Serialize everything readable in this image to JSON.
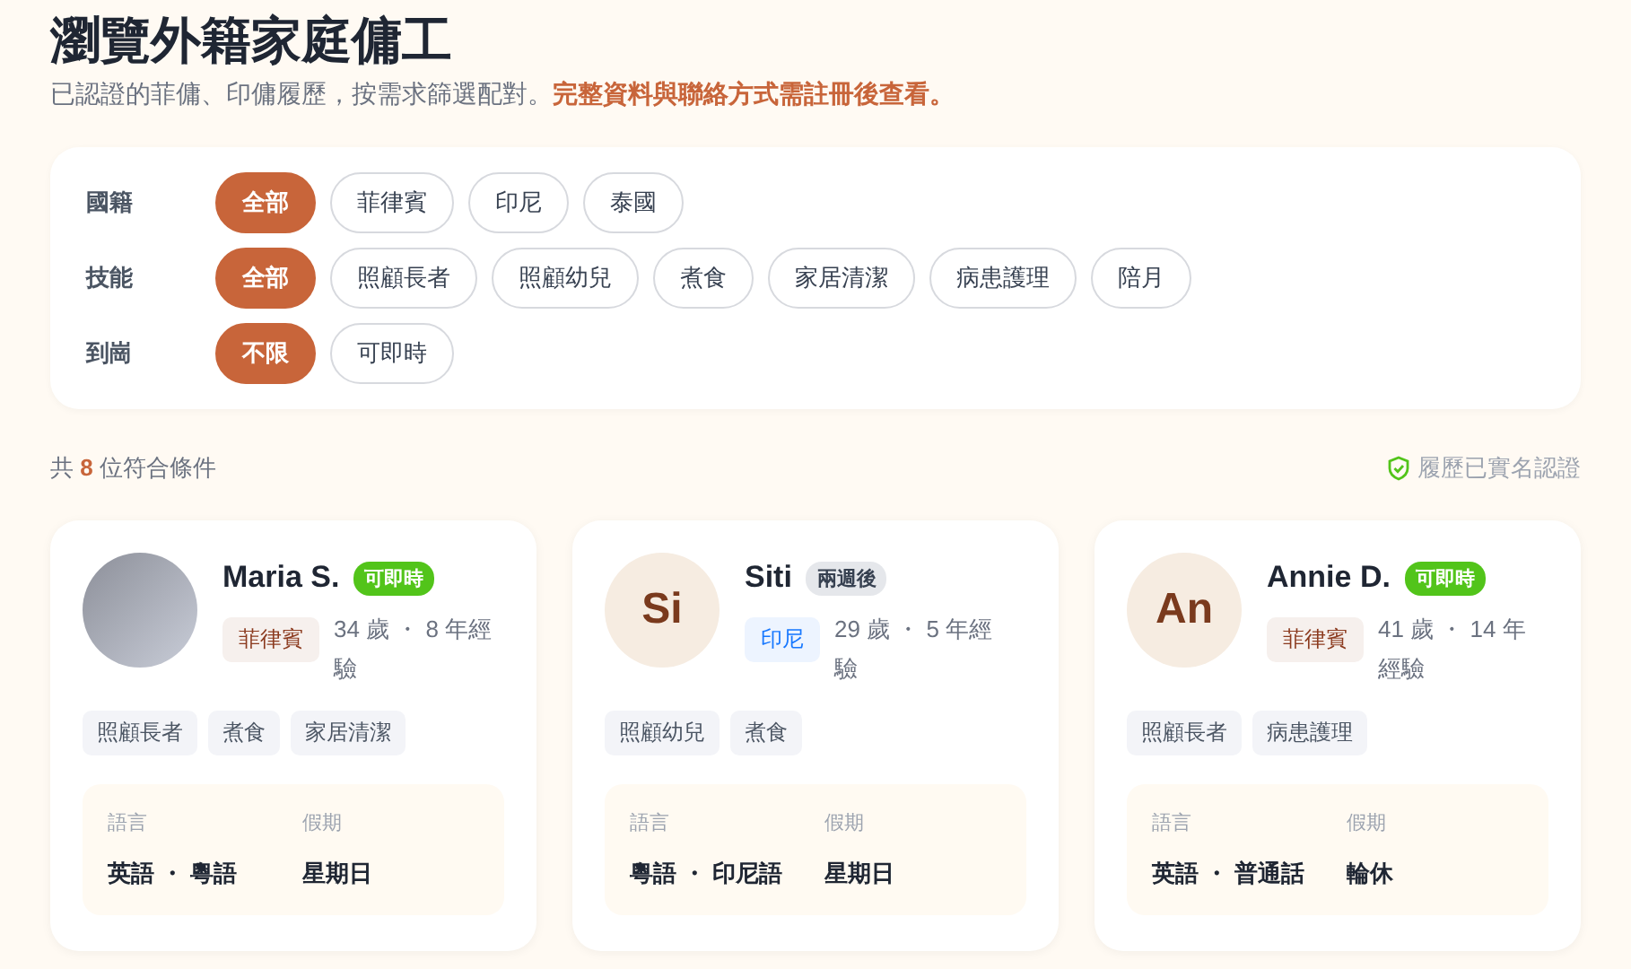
{
  "header": {
    "title": "瀏覽外籍家庭傭工",
    "subtitle": "已認證的菲傭、印傭履歷，按需求篩選配對。**完整資料與聯絡方式需註冊後查看。**"
  },
  "filters": [
    {
      "label": "國籍",
      "options": [
        {
          "label": "全部",
          "selected": true
        },
        {
          "label": "菲律賓",
          "selected": false
        },
        {
          "label": "印尼",
          "selected": false
        },
        {
          "label": "泰國",
          "selected": false
        }
      ]
    },
    {
      "label": "技能",
      "options": [
        {
          "label": "全部",
          "selected": true
        },
        {
          "label": "照顧長者",
          "selected": false
        },
        {
          "label": "照顧幼兒",
          "selected": false
        },
        {
          "label": "煮食",
          "selected": false
        },
        {
          "label": "家居清潔",
          "selected": false
        },
        {
          "label": "病患護理",
          "selected": false
        },
        {
          "label": "陪月",
          "selected": false
        }
      ]
    },
    {
      "label": "到崗",
      "options": [
        {
          "label": "不限",
          "selected": true
        },
        {
          "label": "可即時",
          "selected": false
        }
      ]
    }
  ],
  "results": {
    "count_prefix": "共",
    "count": "8",
    "count_suffix": "位符合條件",
    "verified_note": "履歷已實名認證"
  },
  "cards": [
    {
      "avatar": {
        "kind": "photo"
      },
      "name": "Maria S.",
      "availability": {
        "label": "可即時",
        "color": "#52c41a"
      },
      "nationality": {
        "label": "菲律賓",
        "color": "#8b3a1e"
      },
      "age_experience": "34 歲 ・ 8 年經驗",
      "skills": [
        "照顧長者",
        "煮食",
        "家居清潔"
      ],
      "details": [
        {
          "label": "語言",
          "value": "英語 ・ 粵語"
        },
        {
          "label": "假期",
          "value": "星期日"
        }
      ]
    },
    {
      "avatar": {
        "kind": "initials",
        "initials": "Si"
      },
      "name": "Siti",
      "availability": {
        "label": "兩週後",
        "color": "#e5e7eb"
      },
      "nationality": {
        "label": "印尼",
        "color": "#1677ff"
      },
      "age_experience": "29 歲 ・ 5 年經驗",
      "skills": [
        "照顧幼兒",
        "煮食"
      ],
      "details": [
        {
          "label": "語言",
          "value": "粵語 ・ 印尼語"
        },
        {
          "label": "假期",
          "value": "星期日"
        }
      ]
    },
    {
      "avatar": {
        "kind": "initials",
        "initials": "An"
      },
      "name": "Annie D.",
      "availability": {
        "label": "可即時",
        "color": "#52c41a"
      },
      "nationality": {
        "label": "菲律賓",
        "color": "#8b3a1e"
      },
      "age_experience": "41 歲 ・ 14 年經驗",
      "skills": [
        "照顧長者",
        "病患護理"
      ],
      "details": [
        {
          "label": "語言",
          "value": "英語 ・ 普通話"
        },
        {
          "label": "假期",
          "value": "輪休"
        }
      ]
    }
  ]
}
